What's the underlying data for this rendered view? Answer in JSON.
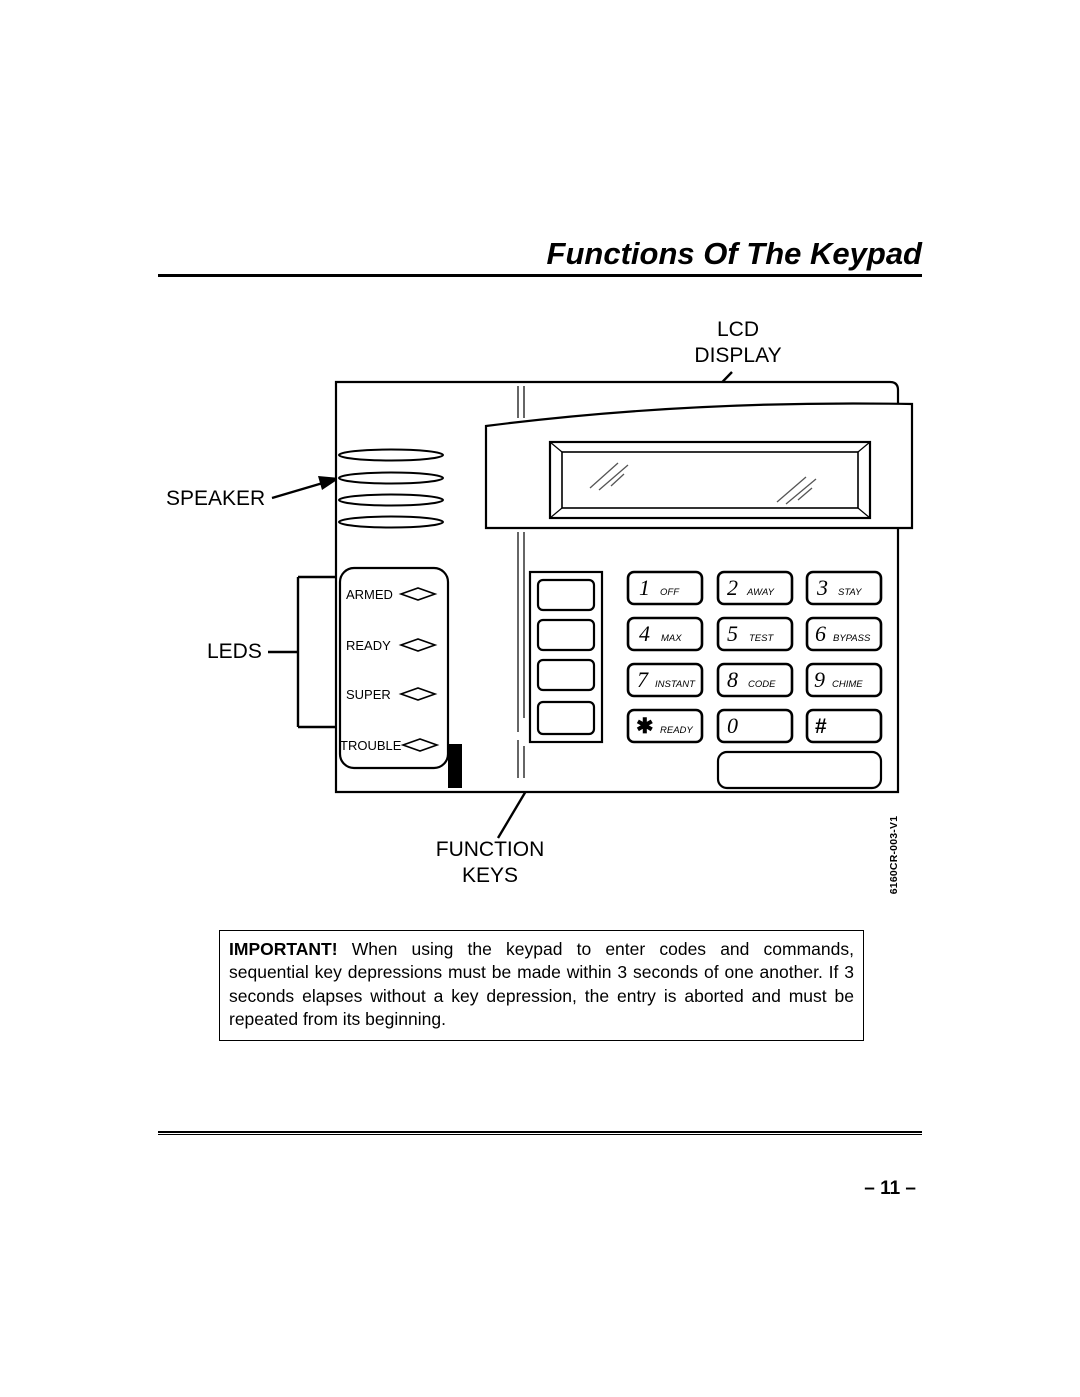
{
  "page": {
    "title": "Functions Of The Keypad",
    "number": "– 11 –",
    "figure_id": "6160CR-003-V1"
  },
  "callouts": {
    "lcd_display_line1": "LCD",
    "lcd_display_line2": "DISPLAY",
    "speaker": "SPEAKER",
    "leds": "LEDS",
    "function_keys_line1": "FUNCTION",
    "function_keys_line2": "KEYS"
  },
  "leds": [
    {
      "label": "ARMED"
    },
    {
      "label": "READY"
    },
    {
      "label": "SUPER"
    },
    {
      "label": "TROUBLE"
    }
  ],
  "keypad": {
    "rows": [
      [
        {
          "digit": "1",
          "word": "OFF"
        },
        {
          "digit": "2",
          "word": "AWAY"
        },
        {
          "digit": "3",
          "word": "STAY"
        }
      ],
      [
        {
          "digit": "4",
          "word": "MAX"
        },
        {
          "digit": "5",
          "word": "TEST"
        },
        {
          "digit": "6",
          "word": "BYPASS"
        }
      ],
      [
        {
          "digit": "7",
          "word": "INSTANT"
        },
        {
          "digit": "8",
          "word": "CODE"
        },
        {
          "digit": "9",
          "word": "CHIME"
        }
      ],
      [
        {
          "digit": "✱",
          "word": "READY"
        },
        {
          "digit": "0",
          "word": ""
        },
        {
          "digit": "#",
          "word": ""
        }
      ]
    ],
    "function_key_count": 4
  },
  "important": {
    "lead": "IMPORTANT!",
    "body": " When using the keypad to enter codes and commands, sequential key depressions must be made within 3 seconds of one another. If 3 seconds elapses without a key depression, the entry is aborted and must be repeated from its beginning."
  },
  "colors": {
    "ink": "#000000",
    "paper": "#ffffff"
  }
}
